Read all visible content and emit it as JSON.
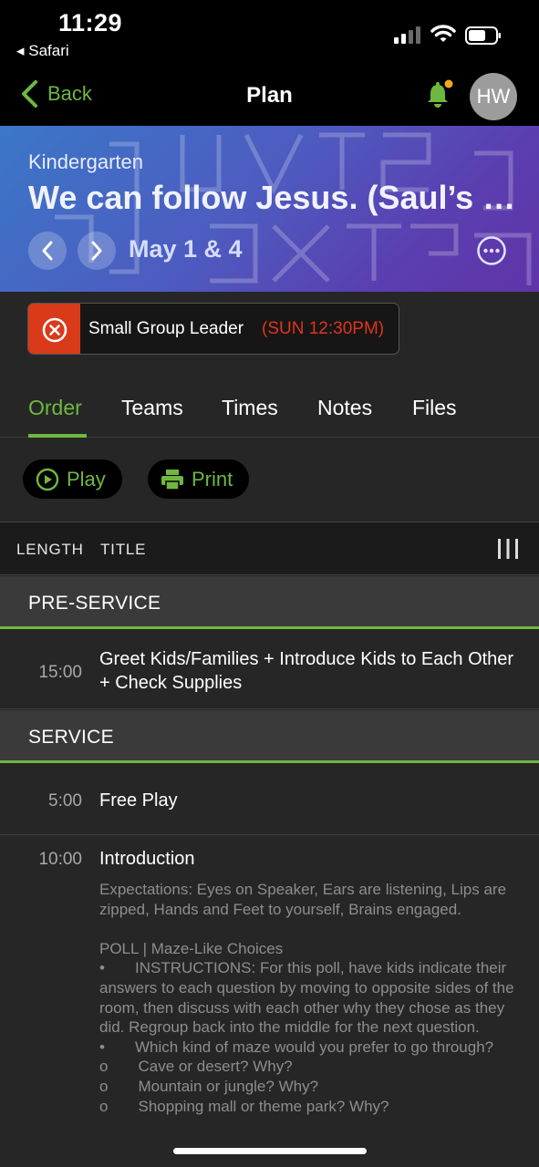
{
  "status_bar": {
    "time": "11:29",
    "back_app": "◂ Safari"
  },
  "nav": {
    "back_label": "Back",
    "title": "Plan",
    "avatar_initials": "HW",
    "accent_color": "#6fb83f",
    "notification_dot_color": "#f5a623"
  },
  "hero": {
    "subtitle": "Kindergarten",
    "title": "We can follow Jesus. (Saul’s Conversion)",
    "date": "May 1 & 4"
  },
  "position": {
    "role": "Small Group Leader",
    "time": "(SUN 12:30PM)",
    "status_color": "#d93a1a"
  },
  "tabs": [
    {
      "label": "Order",
      "active": true
    },
    {
      "label": "Teams",
      "active": false
    },
    {
      "label": "Times",
      "active": false
    },
    {
      "label": "Notes",
      "active": false
    },
    {
      "label": "Files",
      "active": false
    }
  ],
  "actions": {
    "play_label": "Play",
    "print_label": "Print"
  },
  "table_header": {
    "length": "LENGTH",
    "title": "TITLE"
  },
  "sections": [
    {
      "name": "PRE-SERVICE"
    },
    {
      "name": "SERVICE"
    }
  ],
  "items": [
    {
      "length": "15:00",
      "title": "Greet Kids/Families + Introduce Kids to Each Other + Check Supplies"
    },
    {
      "length": "5:00",
      "title": "Free Play"
    },
    {
      "length": "10:00",
      "title": "Introduction",
      "notes": "Expectations: Eyes on Speaker, Ears are listening, Lips are zipped, Hands and Feet to yourself, Brains engaged.\n\nPOLL | Maze-Like Choices\n•       INSTRUCTIONS: For this poll, have kids indicate their answers to each question by moving to opposite sides of the room, then discuss with each other why they chose as they did. Regroup back into the middle for the next question.\n•       Which kind of maze would you prefer to go through?\no       Cave or desert? Why?\no       Mountain or jungle? Why?\no       Shopping mall or theme park? Why?"
    }
  ]
}
